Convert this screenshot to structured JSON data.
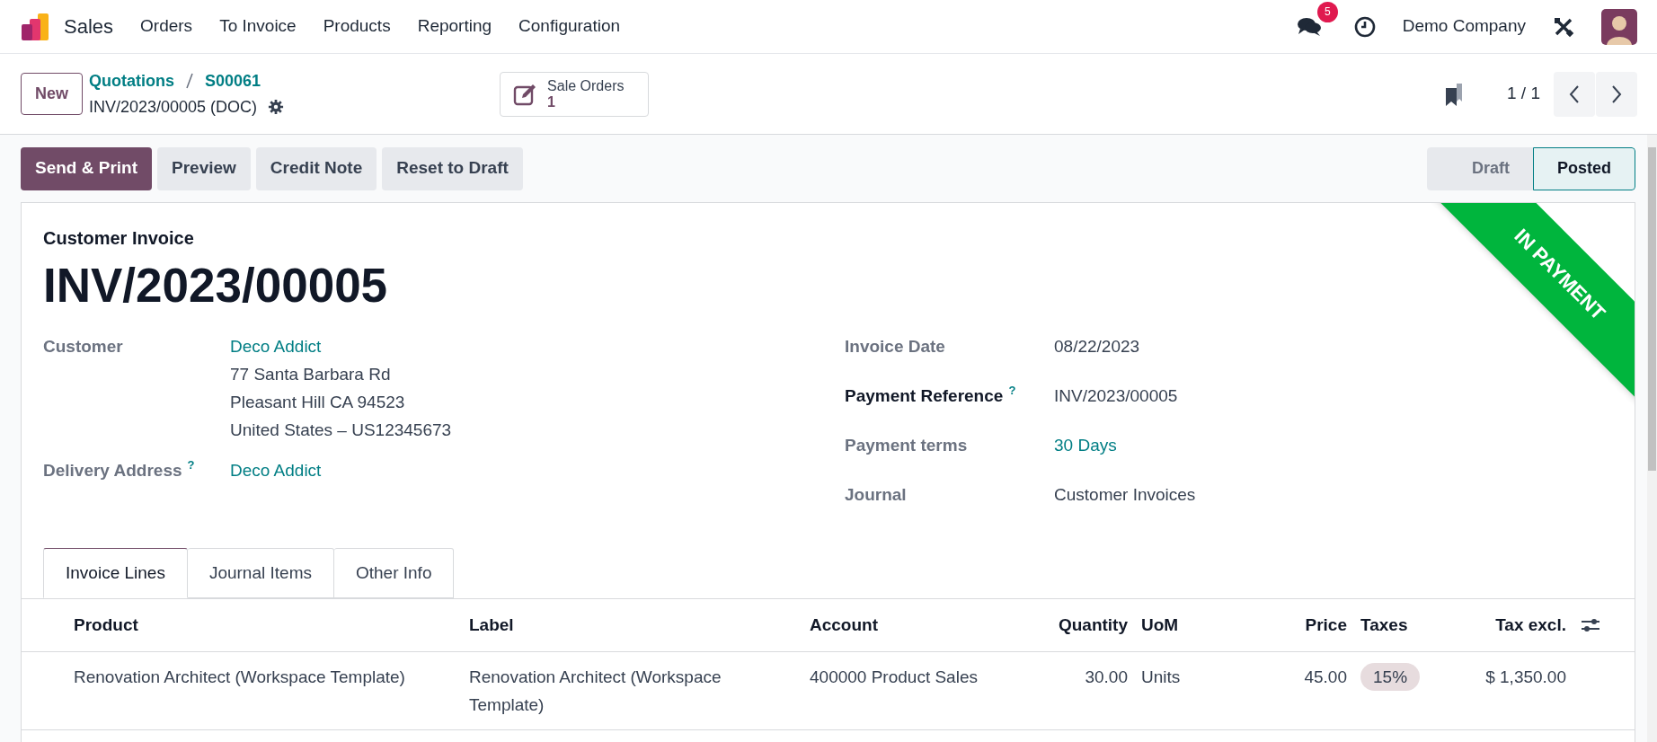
{
  "navbar": {
    "app": "Sales",
    "menu": [
      "Orders",
      "To Invoice",
      "Products",
      "Reporting",
      "Configuration"
    ],
    "messages_badge": "5",
    "company": "Demo Company"
  },
  "control_panel": {
    "new_button": "New",
    "breadcrumbs": [
      "Quotations",
      "S00061"
    ],
    "record": "INV/2023/00005 (DOC)",
    "smart_button": {
      "label": "Sale Orders",
      "count": "1"
    },
    "pager": "1 / 1"
  },
  "actions": [
    {
      "label": "Send & Print",
      "primary": true
    },
    {
      "label": "Preview",
      "primary": false
    },
    {
      "label": "Credit Note",
      "primary": false
    },
    {
      "label": "Reset to Draft",
      "primary": false
    }
  ],
  "statusbar": [
    {
      "label": "Draft",
      "selected": false
    },
    {
      "label": "Posted",
      "selected": true
    }
  ],
  "form": {
    "type": "Customer Invoice",
    "title": "INV/2023/00005",
    "ribbon": "IN PAYMENT",
    "left_fields": [
      {
        "label": "Customer",
        "required": false,
        "value": "Deco Addict",
        "link": true,
        "lines": [
          "77 Santa Barbara Rd",
          "Pleasant Hill CA 94523",
          "United States – US12345673"
        ]
      },
      {
        "label": "Delivery Address",
        "help": "?",
        "required": false,
        "value": "Deco Addict",
        "link": true
      }
    ],
    "right_fields": [
      {
        "label": "Invoice Date",
        "required": false,
        "value": "08/22/2023",
        "link": false
      },
      {
        "label": "Payment Reference",
        "help": "?",
        "required": true,
        "value": "INV/2023/00005",
        "link": false
      },
      {
        "label": "Payment terms",
        "required": false,
        "value": "30 Days",
        "link": true
      },
      {
        "label": "Journal",
        "required": false,
        "value": "Customer Invoices",
        "link": false
      }
    ]
  },
  "tabs": [
    {
      "label": "Invoice Lines",
      "selected": true
    },
    {
      "label": "Journal Items",
      "selected": false
    },
    {
      "label": "Other Info",
      "selected": false
    }
  ],
  "table": {
    "columns": [
      {
        "label": "Product",
        "kind": "text"
      },
      {
        "label": "Label",
        "kind": "text"
      },
      {
        "label": "Account",
        "kind": "text"
      },
      {
        "label": "Quantity",
        "kind": "number"
      },
      {
        "label": "UoM",
        "kind": "text"
      },
      {
        "label": "Price",
        "kind": "number"
      },
      {
        "label": "Taxes",
        "kind": "tag"
      },
      {
        "label": "Tax excl.",
        "kind": "number"
      }
    ],
    "rows": [
      {
        "cells": [
          "Renovation Architect (Workspace Template)",
          "Renovation Architect (Workspace Template)",
          "400000 Product Sales",
          "30.00",
          "Units",
          "45.00",
          "15%",
          "$ 1,350.00"
        ]
      }
    ]
  }
}
